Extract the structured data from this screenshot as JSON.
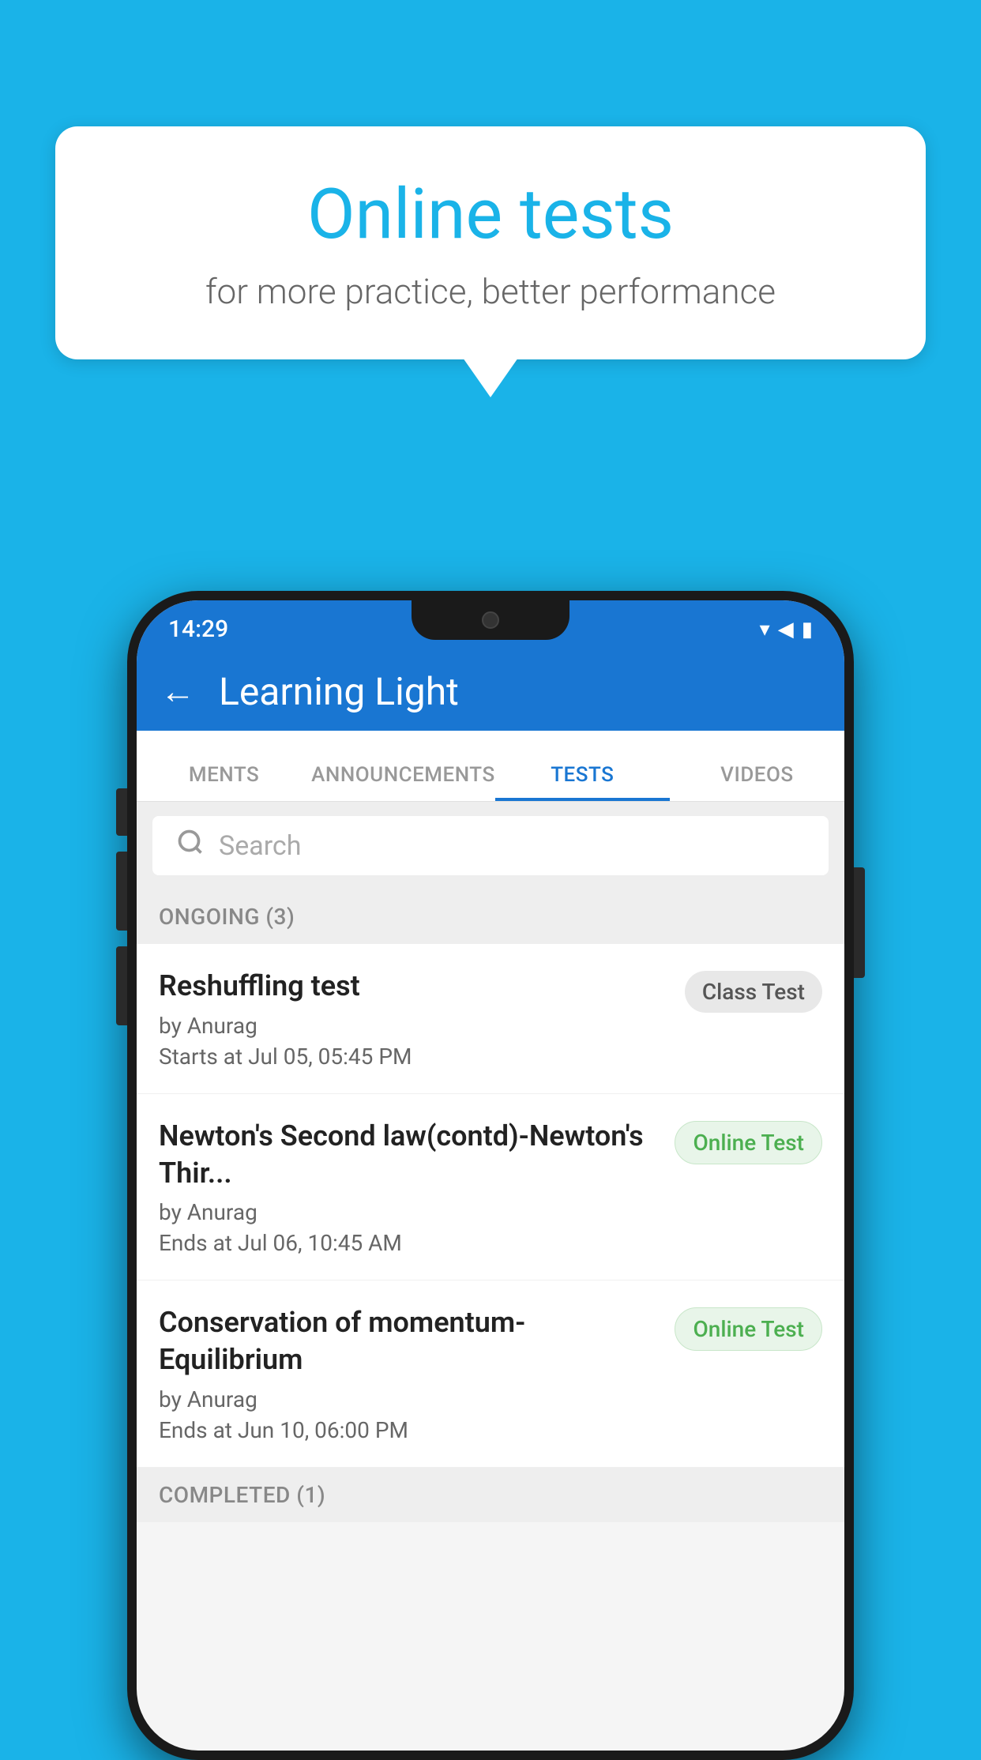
{
  "background_color": "#1ab3e8",
  "speech_bubble": {
    "title": "Online tests",
    "subtitle": "for more practice, better performance"
  },
  "phone": {
    "status_bar": {
      "time": "14:29",
      "icons": [
        "wifi",
        "signal",
        "battery"
      ]
    },
    "app_bar": {
      "title": "Learning Light",
      "back_label": "←"
    },
    "tabs": [
      {
        "label": "MENTS",
        "active": false
      },
      {
        "label": "ANNOUNCEMENTS",
        "active": false
      },
      {
        "label": "TESTS",
        "active": true
      },
      {
        "label": "VIDEOS",
        "active": false
      }
    ],
    "search": {
      "placeholder": "Search"
    },
    "sections": [
      {
        "header": "ONGOING (3)",
        "tests": [
          {
            "title": "Reshuffling test",
            "author": "by Anurag",
            "time_label": "Starts at",
            "time": "Jul 05, 05:45 PM",
            "badge": "Class Test",
            "badge_type": "class"
          },
          {
            "title": "Newton's Second law(contd)-Newton's Thir...",
            "author": "by Anurag",
            "time_label": "Ends at",
            "time": "Jul 06, 10:45 AM",
            "badge": "Online Test",
            "badge_type": "online"
          },
          {
            "title": "Conservation of momentum-Equilibrium",
            "author": "by Anurag",
            "time_label": "Ends at",
            "time": "Jun 10, 06:00 PM",
            "badge": "Online Test",
            "badge_type": "online"
          }
        ]
      }
    ],
    "completed_header": "COMPLETED (1)"
  }
}
